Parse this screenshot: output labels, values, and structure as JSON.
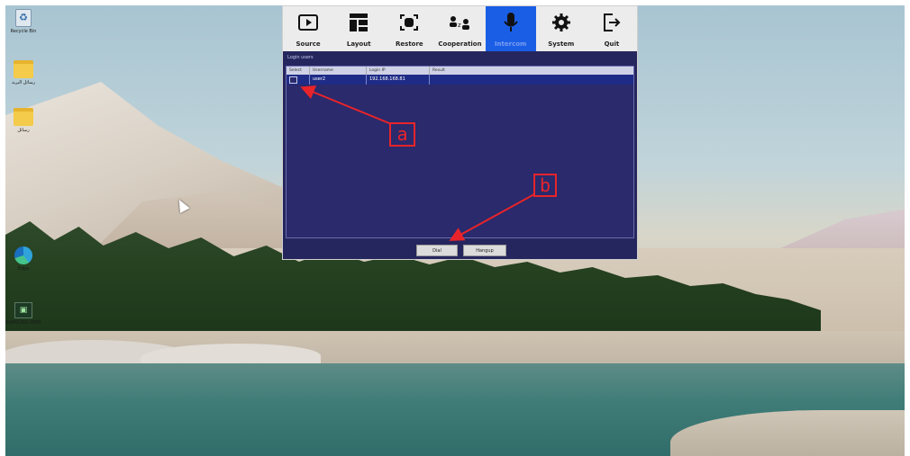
{
  "desktop": {
    "icons": [
      {
        "label": "Recycle Bin",
        "kind": "recycle"
      },
      {
        "label": "رسائل البريد",
        "kind": "folder"
      },
      {
        "label": "رسائل",
        "kind": "folder"
      },
      {
        "label": "Edge",
        "kind": "edge"
      },
      {
        "label": "SAMSUNG SEMI-SET",
        "kind": "shortcut"
      }
    ]
  },
  "app": {
    "toolbar": [
      {
        "label": "Source",
        "icon": "play-icon",
        "active": false
      },
      {
        "label": "Layout",
        "icon": "layout-icon",
        "active": false
      },
      {
        "label": "Restore",
        "icon": "restore-icon",
        "active": false
      },
      {
        "label": "Cooperation",
        "icon": "cooperation-icon",
        "active": false
      },
      {
        "label": "Intercom",
        "icon": "microphone-icon",
        "active": true
      },
      {
        "label": "System",
        "icon": "gear-icon",
        "active": false
      },
      {
        "label": "Quit",
        "icon": "exit-icon",
        "active": false
      }
    ],
    "panel_title": "Login users",
    "table": {
      "headers": [
        "Select",
        "Username",
        "Login IP",
        "Result"
      ],
      "rows": [
        {
          "selected": false,
          "username": "user2",
          "login_ip": "192.168.168.81",
          "result": ""
        }
      ]
    },
    "buttons": {
      "dial": "Dial",
      "hangup": "Hangup"
    }
  },
  "annotations": {
    "a": "a",
    "b": "b",
    "color": "#e8242a"
  },
  "colors": {
    "window_bg": "#26265e",
    "row_bg": "#1f2c87",
    "active_tab": "#1b5ee6"
  }
}
